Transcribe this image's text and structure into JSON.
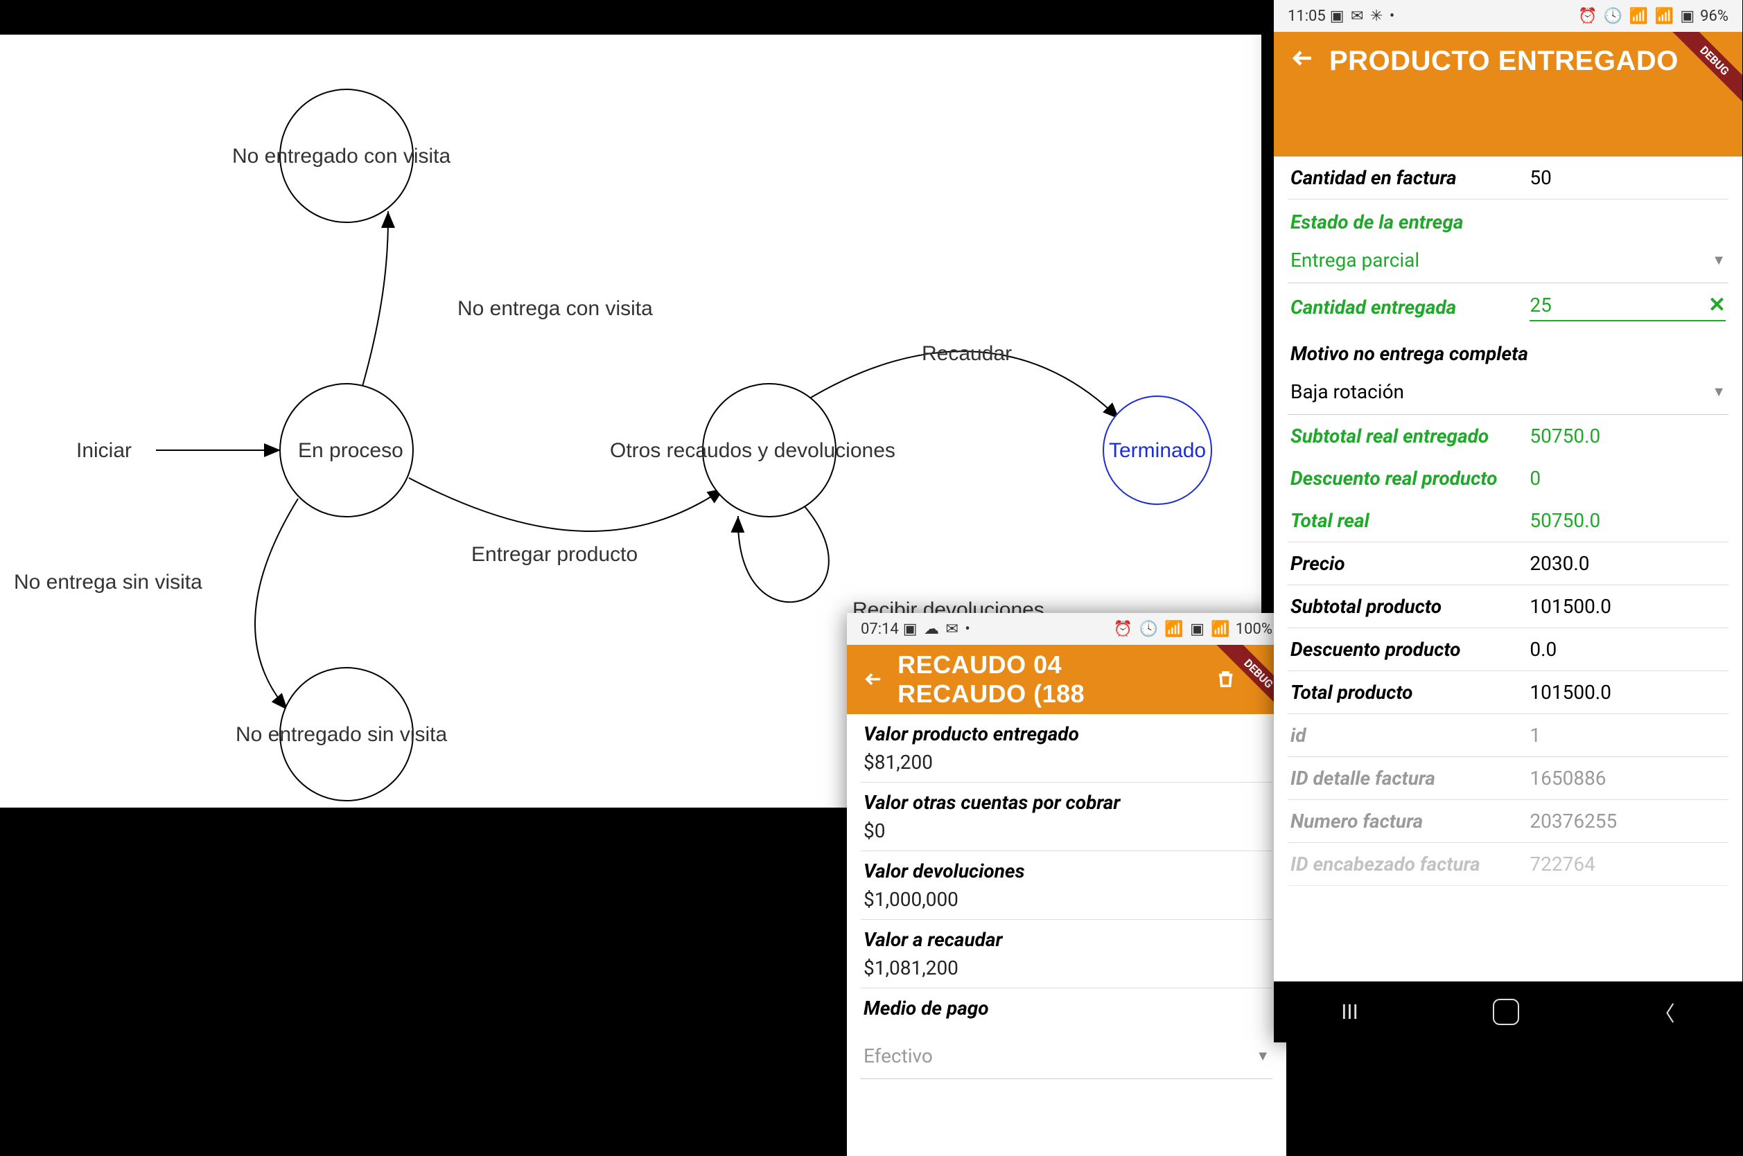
{
  "diagram": {
    "nodes": {
      "iniciar": "Iniciar",
      "en_proceso": "En proceso",
      "no_entregado_con_visita": "No entregado con visita",
      "no_entregado_sin_visita": "No entregado sin visita",
      "otros": "Otros recaudos y devoluciones",
      "terminado": "Terminado"
    },
    "edges": {
      "no_entrega_con_visita": "No entrega con visita",
      "no_entrega_sin_visita": "No entrega sin visita",
      "entregar_producto": "Entregar producto",
      "recibir_devoluciones": "Recibir devoluciones",
      "recaudar": "Recaudar"
    }
  },
  "phone_right": {
    "statusbar": {
      "time": "11:05",
      "icons_left": "▣ ✉ ✳ •",
      "icons_right": "⏰ 🕓 📶 📶 ▣",
      "battery": "96%"
    },
    "title": "PRODUCTO ENTREGADO",
    "rows": {
      "cantidad_en_factura": {
        "label": "Cantidad en factura",
        "value": "50"
      },
      "estado_de_la_entrega": {
        "label": "Estado de la entrega"
      },
      "entrega_dropdown": "Entrega parcial",
      "cantidad_entregada": {
        "label": "Cantidad entregada",
        "value": "25"
      },
      "motivo_no_entrega": {
        "label": "Motivo no entrega completa"
      },
      "motivo_dropdown": "Baja rotación",
      "subtotal_real_entregado": {
        "label": "Subtotal real entregado",
        "value": "50750.0"
      },
      "descuento_real_producto": {
        "label": "Descuento real producto",
        "value": "0"
      },
      "total_real": {
        "label": "Total real",
        "value": "50750.0"
      },
      "precio": {
        "label": "Precio",
        "value": "2030.0"
      },
      "subtotal_producto": {
        "label": "Subtotal producto",
        "value": "101500.0"
      },
      "descuento_producto": {
        "label": "Descuento producto",
        "value": "0.0"
      },
      "total_producto": {
        "label": "Total producto",
        "value": "101500.0"
      },
      "id": {
        "label": "id",
        "value": "1"
      },
      "id_detalle_factura": {
        "label": "ID detalle factura",
        "value": "1650886"
      },
      "numero_factura": {
        "label": "Numero factura",
        "value": "20376255"
      },
      "id_encabezado_factura": {
        "label": "ID encabezado factura",
        "value": "722764"
      }
    }
  },
  "phone_middle": {
    "statusbar": {
      "time": "07:14",
      "icons_left": "▣ ☁ ✉ •",
      "icons_right": "⏰ 🕓 📶 ▣ 📶",
      "battery": "100%"
    },
    "title": "RECAUDO 04 RECAUDO (188",
    "blocks": {
      "valor_producto_entregado": {
        "label": "Valor producto entregado",
        "value": "$81,200"
      },
      "valor_otras_cuentas": {
        "label": "Valor otras cuentas por cobrar",
        "value": "$0"
      },
      "valor_devoluciones": {
        "label": "Valor devoluciones",
        "value": "$1,000,000"
      },
      "valor_a_recaudar": {
        "label": "Valor a recaudar",
        "value": "$1,081,200"
      },
      "medio_de_pago": {
        "label": "Medio de pago"
      },
      "medio_dropdown": "Efectivo"
    }
  }
}
